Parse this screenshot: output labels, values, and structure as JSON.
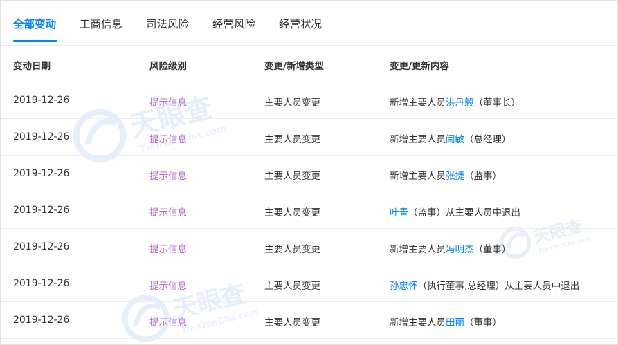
{
  "tabs": [
    {
      "label": "全部变动"
    },
    {
      "label": "工商信息"
    },
    {
      "label": "司法风险"
    },
    {
      "label": "经营风险"
    },
    {
      "label": "经营状况"
    }
  ],
  "columns": [
    "变动日期",
    "风险级别",
    "变更/新增类型",
    "变更/更新内容"
  ],
  "rows": [
    {
      "date": "2019-12-26",
      "level": "提示信息",
      "type": "主要人员变更",
      "pre": "新增主要人员",
      "link": "洪丹毅",
      "post": "（董事长）"
    },
    {
      "date": "2019-12-26",
      "level": "提示信息",
      "type": "主要人员变更",
      "pre": "新增主要人员",
      "link": "闫敏",
      "post": "（总经理）"
    },
    {
      "date": "2019-12-26",
      "level": "提示信息",
      "type": "主要人员变更",
      "pre": "新增主要人员",
      "link": "张捷",
      "post": "（监事）"
    },
    {
      "date": "2019-12-26",
      "level": "提示信息",
      "type": "主要人员变更",
      "pre": "",
      "link": "叶青",
      "post": "（监事）从主要人员中退出"
    },
    {
      "date": "2019-12-26",
      "level": "提示信息",
      "type": "主要人员变更",
      "pre": "新增主要人员",
      "link": "冯明杰",
      "post": "（董事）"
    },
    {
      "date": "2019-12-26",
      "level": "提示信息",
      "type": "主要人员变更",
      "pre": "",
      "link": "孙忠怀",
      "post": "（执行董事,总经理）从主要人员中退出"
    },
    {
      "date": "2019-12-26",
      "level": "提示信息",
      "type": "主要人员变更",
      "pre": "新增主要人员",
      "link": "田丽",
      "post": "（董事）"
    }
  ],
  "watermark": {
    "brand": "天眼查",
    "sub": "TianYanCha.com"
  },
  "colors": {
    "accent": "#0084ff",
    "risk_level": "#b068d3",
    "watermark": "#dbe9f7"
  }
}
